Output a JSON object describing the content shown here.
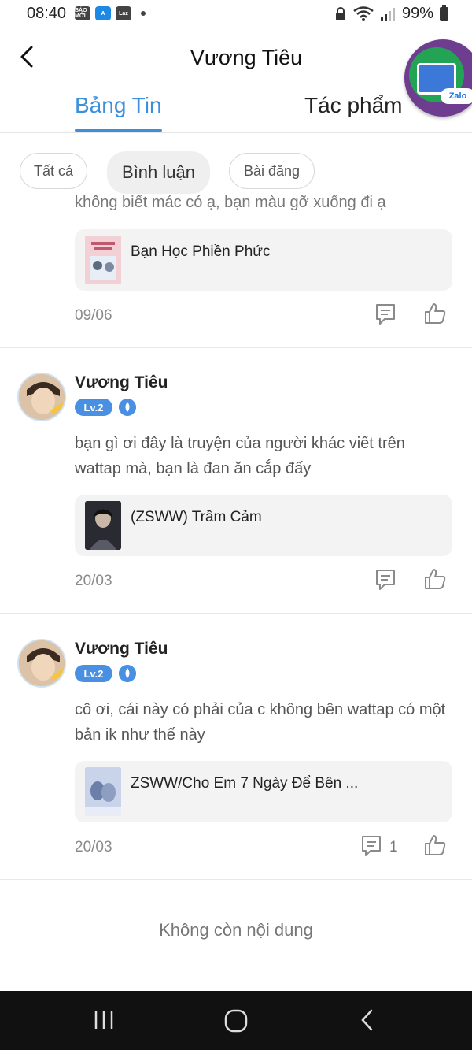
{
  "status_bar": {
    "time": "08:40",
    "app_icons": [
      "BÁO MỚI",
      "A",
      "Laz"
    ],
    "battery": "99%"
  },
  "header": {
    "title": "Vương Tiêu",
    "bubble_label": "Zalo"
  },
  "tabs": [
    {
      "label": "Bảng Tin",
      "active": true
    },
    {
      "label": "Tác phẩm",
      "active": false
    }
  ],
  "filters": [
    {
      "label": "Tất cả",
      "selected": false
    },
    {
      "label": "Bình luận",
      "selected": true
    },
    {
      "label": "Bài đăng",
      "selected": false
    }
  ],
  "first_item": {
    "partial_text": "không biết mác có ạ, bạn màu gỡ xuống đi ạ",
    "story_title": "Bạn Học Phiền Phức",
    "date": "09/06"
  },
  "posts": [
    {
      "author": "Vương Tiêu",
      "level": "Lv.2",
      "text": "bạn gì ơi đây là truyện của người khác viết trên wattap mà, bạn là đan ăn cắp đấy",
      "story_title": "(ZSWW) Trầm Cảm",
      "date": "20/03",
      "comment_count": ""
    },
    {
      "author": "Vương Tiêu",
      "level": "Lv.2",
      "text": "cô ơi, cái này có phải của c không bên wattap có một bản ik như thế này",
      "story_title": "ZSWW/Cho Em 7 Ngày Để Bên ...",
      "date": "20/03",
      "comment_count": "1"
    }
  ],
  "end_message": "Không còn nội dung",
  "colors": {
    "accent": "#3b8fdc",
    "card_bg": "#f3f3f3",
    "nav_bg": "#111111"
  }
}
